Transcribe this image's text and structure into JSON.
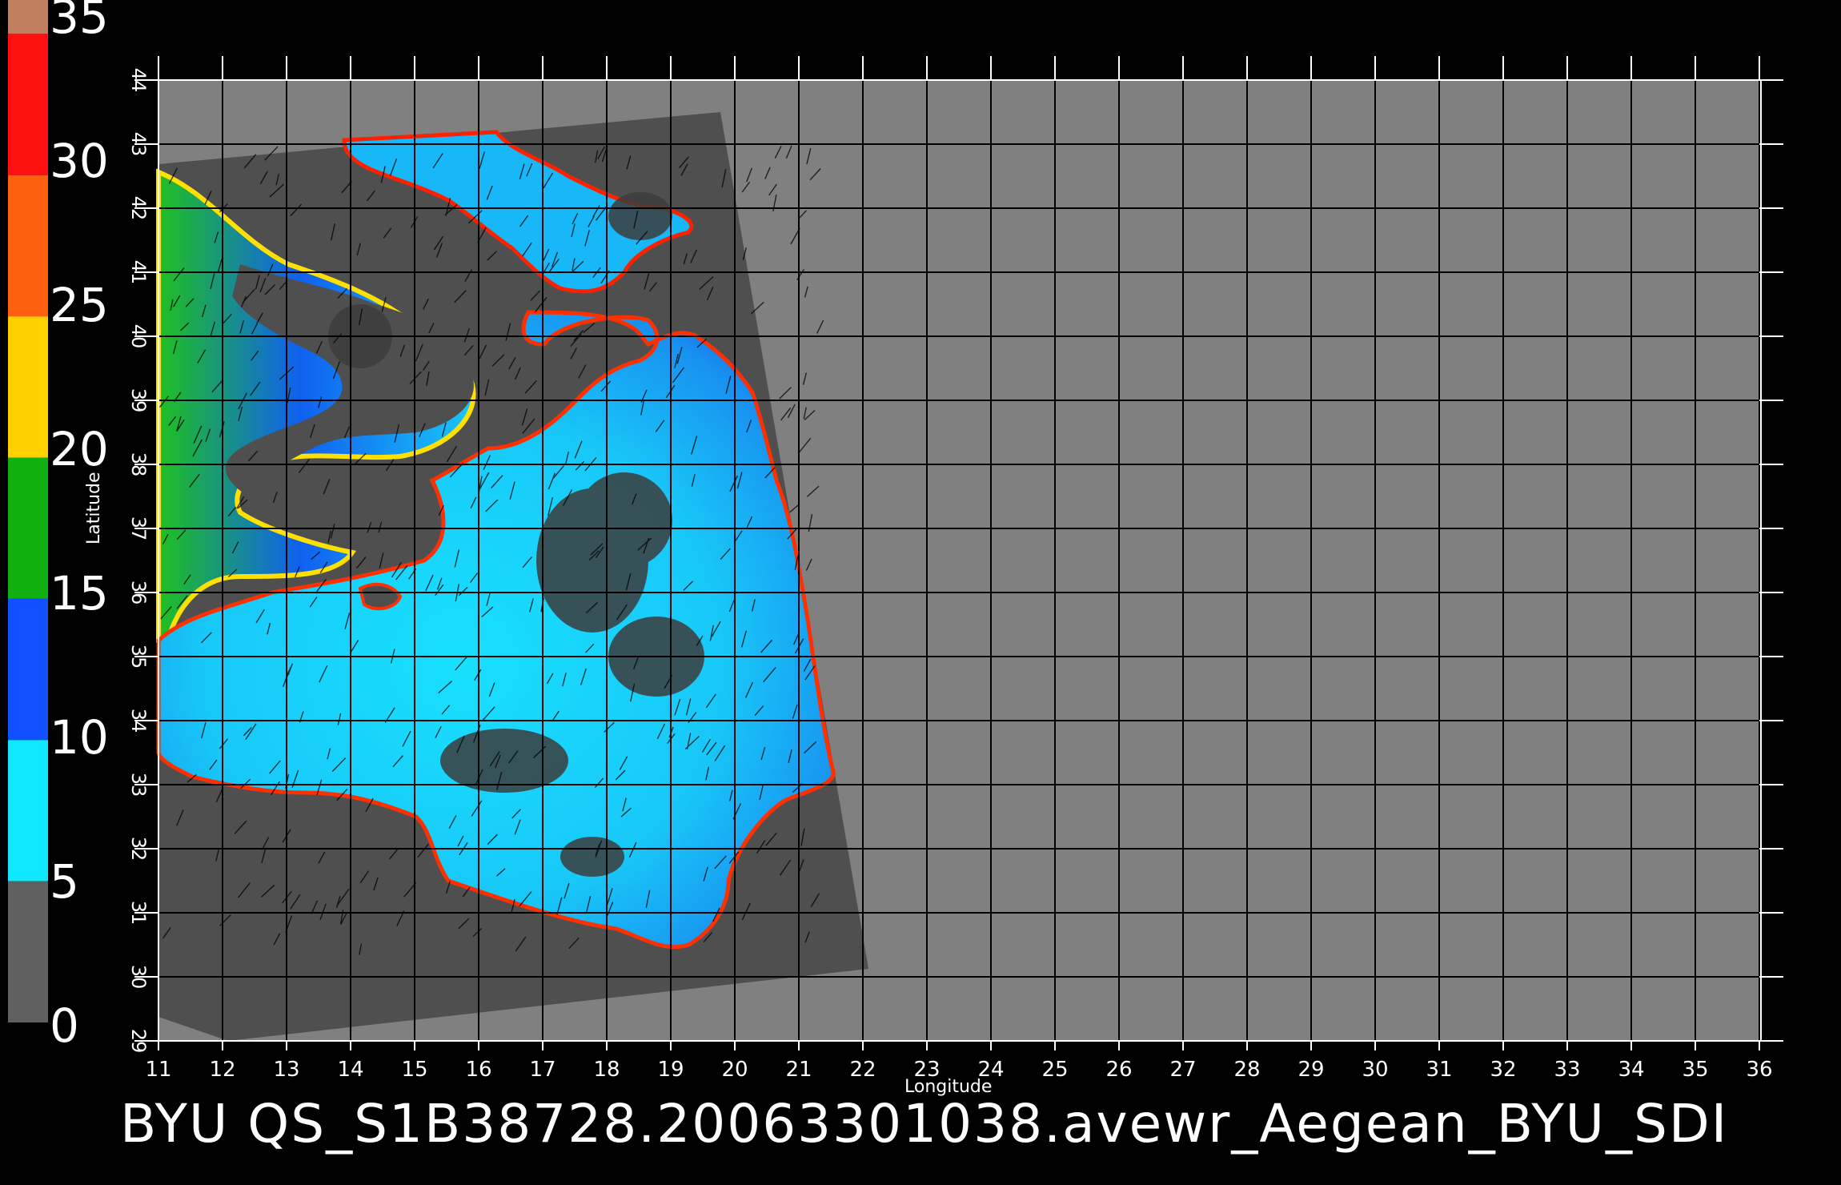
{
  "caption": "BYU QS_S1B38728.20063301038.avewr_Aegean_BYU_SDI",
  "axes": {
    "xlabel": "Longitude",
    "ylabel": "Latitude",
    "lon_ticks": [
      "11",
      "12",
      "13",
      "14",
      "15",
      "16",
      "17",
      "18",
      "19",
      "20",
      "21",
      "22",
      "23",
      "24",
      "25",
      "26",
      "27",
      "28",
      "29",
      "30",
      "31",
      "32",
      "33",
      "34",
      "35",
      "36"
    ],
    "lat_ticks": [
      "29",
      "30",
      "31",
      "32",
      "33",
      "34",
      "35",
      "36",
      "37",
      "38",
      "39",
      "40",
      "41",
      "42",
      "43",
      "44"
    ]
  },
  "colorbar": {
    "labels": [
      "35",
      "30",
      "25",
      "20",
      "15",
      "10",
      "5",
      "0"
    ],
    "colors": [
      "#c08060",
      "#ff1010",
      "#ff6010",
      "#ffd000",
      "#10b010",
      "#1050ff",
      "#10e8ff",
      "#606060"
    ]
  },
  "colors": {
    "background": "#000000",
    "plot_bg": "#808080",
    "swath": "#4f4f4f",
    "ocean_light": "#18d8f8",
    "ocean_mid": "#1890f0",
    "ocean_dark": "#1048e8",
    "coast_yellow": "#ffe000",
    "coast_red": "#ff2000",
    "gridline": "#000000"
  }
}
